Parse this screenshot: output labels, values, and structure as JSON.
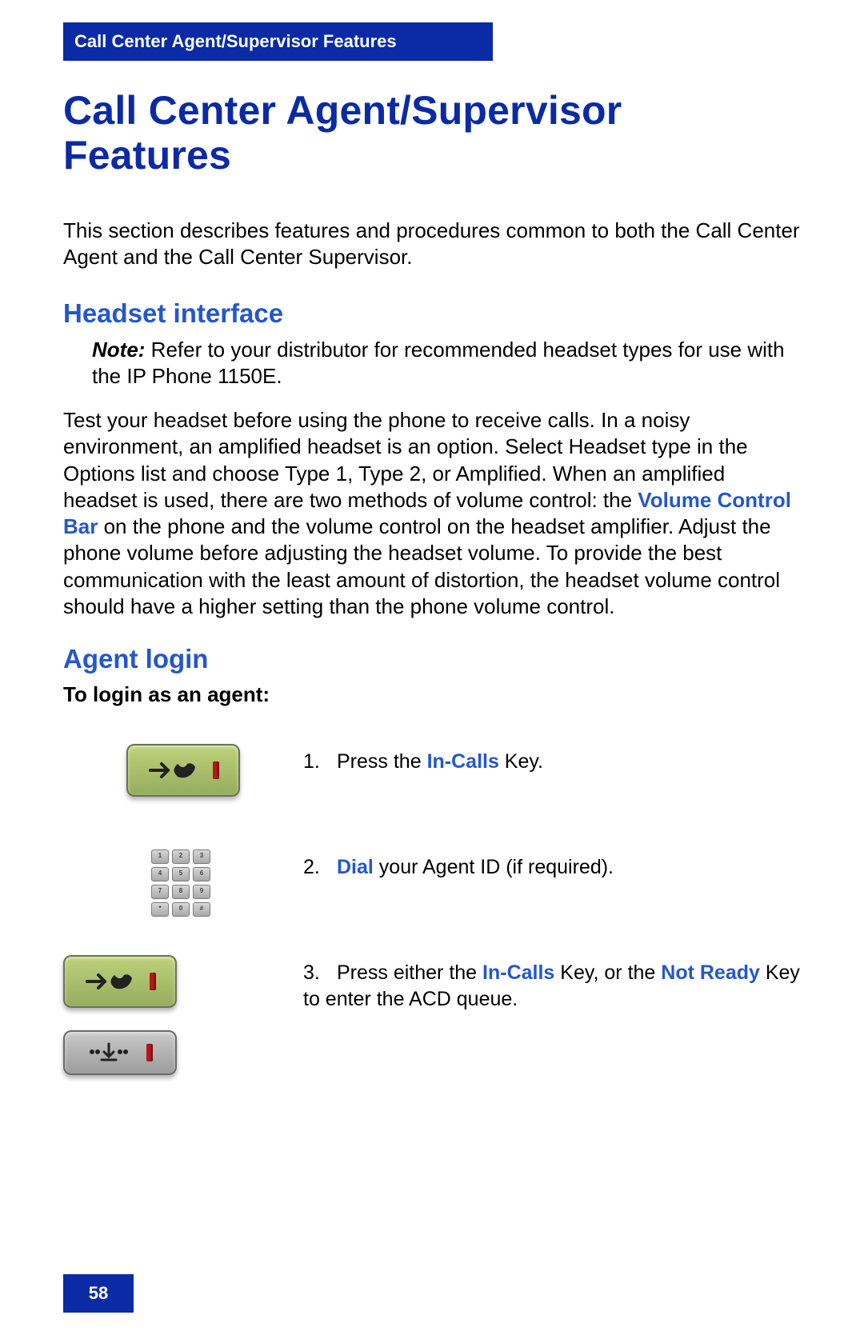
{
  "header": {
    "title": "Call Center Agent/Supervisor Features"
  },
  "page": {
    "title": "Call Center Agent/Supervisor Features",
    "intro": "This section describes features and procedures common to both the Call Center Agent and the Call Center Supervisor."
  },
  "sections": {
    "headset": {
      "heading": "Headset interface",
      "note_label": "Note:",
      "note_text": " Refer to your distributor for recommended headset types for use with the IP Phone 1150E.",
      "para_before_link": "Test your headset before using the phone to receive calls. In a noisy environment, an amplified headset is an option. Select Headset type in the Options list and choose Type 1, Type 2, or Amplified. When an amplified headset is used, there are two methods of volume control: the ",
      "link_text": "Volume Control Bar",
      "para_after_link": " on the phone and the volume control on the headset amplifier. Adjust the phone volume before adjusting the headset volume. To provide the best communication with the least amount of distortion, the headset volume control should have a higher setting than the phone volume control."
    },
    "agent_login": {
      "heading": "Agent login",
      "sub": "To login as an agent:",
      "steps": [
        {
          "num": "1.",
          "pre": "Press the ",
          "term1": "In-Calls",
          "mid": " Key.",
          "term2": "",
          "post": ""
        },
        {
          "num": "2.",
          "pre": "",
          "term1": "Dial",
          "mid": " your Agent ID (if required).",
          "term2": "",
          "post": ""
        },
        {
          "num": "3.",
          "pre": "Press either the ",
          "term1": "In-Calls",
          "mid": " Key, or the ",
          "term2": "Not Ready",
          "post": " Key to enter the ACD queue."
        }
      ]
    }
  },
  "footer": {
    "page_number": "58"
  },
  "colors": {
    "brand_blue": "#0b2aa5",
    "link_blue": "#2457cc"
  }
}
